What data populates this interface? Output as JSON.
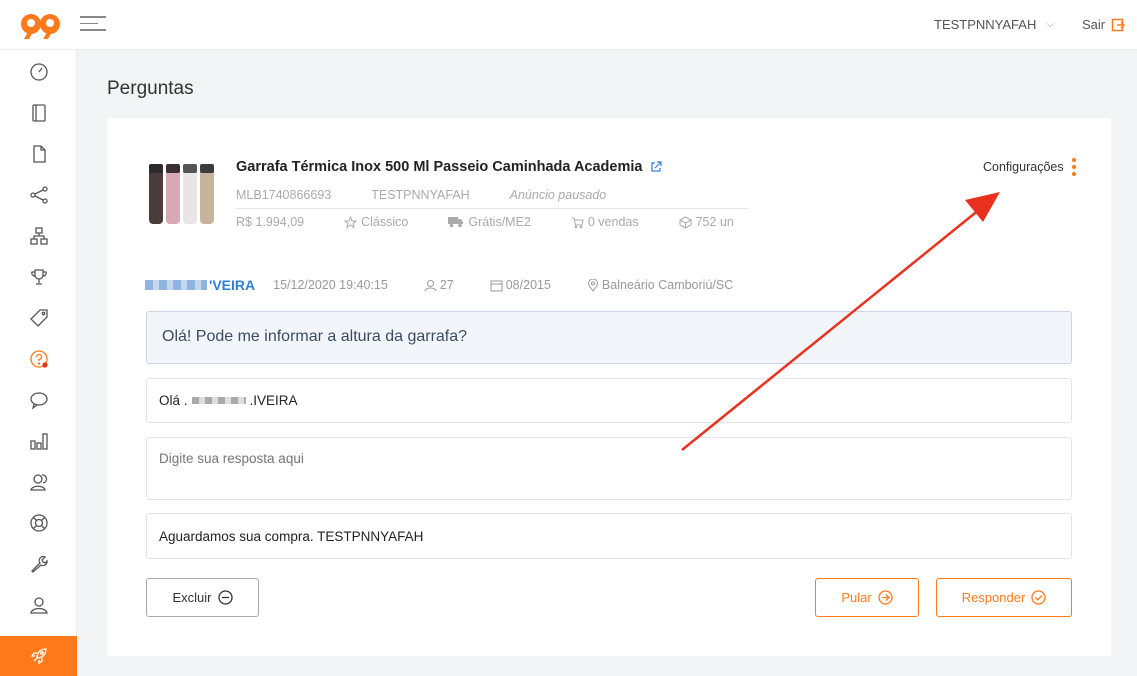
{
  "header": {
    "user_name": "TESTPNNYAFAH",
    "logout_label": "Sair"
  },
  "colors": {
    "accent": "#ff7a1a",
    "link": "#2f7fd9",
    "annotation_arrow": "#e8311e"
  },
  "sidebar": {
    "items": [
      {
        "icon": "dashboard-icon"
      },
      {
        "icon": "notebook-icon"
      },
      {
        "icon": "document-icon"
      },
      {
        "icon": "share-icon"
      },
      {
        "icon": "hierarchy-icon"
      },
      {
        "icon": "trophy-icon"
      },
      {
        "icon": "tag-icon"
      },
      {
        "icon": "question-icon",
        "badge": true
      },
      {
        "icon": "chat-icon"
      },
      {
        "icon": "bar-chart-icon"
      },
      {
        "icon": "users-icon"
      },
      {
        "icon": "lifebuoy-icon"
      },
      {
        "icon": "wrench-icon"
      },
      {
        "icon": "user-icon"
      },
      {
        "icon": "rocket-icon",
        "active": true
      }
    ]
  },
  "page": {
    "title": "Perguntas"
  },
  "product": {
    "title": "Garrafa Térmica Inox 500 Ml Passeio Caminhada Academia",
    "id": "MLB1740866693",
    "seller": "TESTPNNYAFAH",
    "status": "Anúncio pausado",
    "price": "R$ 1.994,09",
    "listing_type": "Clássico",
    "shipping": "Grátis/ME2",
    "sales": "0 vendas",
    "stock": "752 un"
  },
  "settings_label": "Configurações",
  "question_meta": {
    "buyer_suffix": "'VEIRA",
    "datetime": "15/12/2020 19:40:15",
    "buyer_rating": "27",
    "member_since": "08/2015",
    "location": "Balneário Camboriú/SC"
  },
  "question": {
    "text": "Olá! Pode me informar a altura da garrafa?"
  },
  "reply": {
    "greeting_prefix": "Olá .",
    "greeting_suffix": ".IVEIRA",
    "placeholder": "Digite sua resposta aqui",
    "signature": "Aguardamos sua compra. TESTPNNYAFAH"
  },
  "actions": {
    "delete_label": "Excluir",
    "skip_label": "Pular",
    "reply_label": "Responder"
  }
}
